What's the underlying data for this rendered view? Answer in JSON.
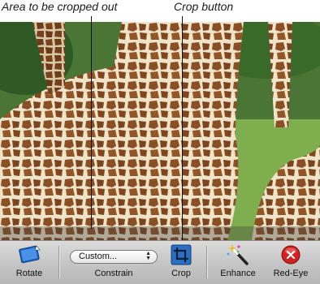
{
  "callouts": {
    "area_label": "Area to be cropped out",
    "crop_label": "Crop button"
  },
  "toolbar": {
    "rotate_label": "Rotate",
    "rotate_icon": "rotate-icon",
    "constrain_label": "Constrain",
    "constrain_value": "Custom...",
    "crop_label": "Crop",
    "crop_icon": "crop-icon",
    "enhance_label": "Enhance",
    "enhance_icon": "magic-wand-icon",
    "redeye_label": "Red-Eye",
    "redeye_icon": "red-eye-icon"
  },
  "colors": {
    "toolbar_bg": "#c6c6c6",
    "crop_icon_blue": "#2a6fc2",
    "redeye_red": "#d42020"
  }
}
